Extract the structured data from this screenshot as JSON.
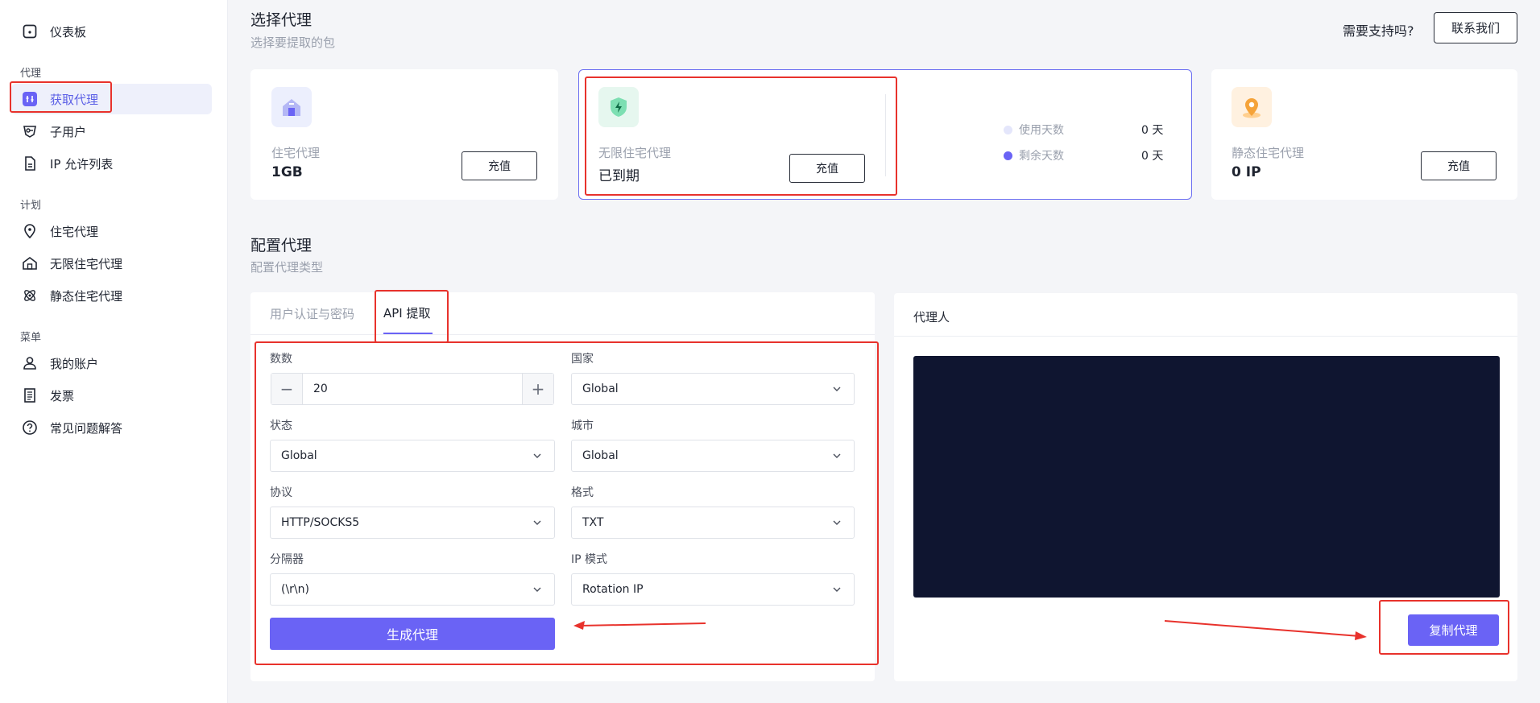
{
  "sidebar": {
    "dashboard": "仪表板",
    "section_proxy": "代理",
    "get_proxy": "获取代理",
    "sub_users": "子用户",
    "ip_allowlist": "IP 允许列表",
    "section_plan": "计划",
    "residential": "住宅代理",
    "unlimited_residential": "无限住宅代理",
    "static_residential": "静态住宅代理",
    "section_menu": "菜单",
    "my_account": "我的账户",
    "invoices": "发票",
    "faq": "常见问题解答"
  },
  "header": {
    "title": "选择代理",
    "subtitle": "选择要提取的包",
    "support_text": "需要支持吗?",
    "contact_label": "联系我们"
  },
  "cards": {
    "residential": {
      "label": "住宅代理",
      "value": "1GB",
      "button": "充值"
    },
    "unlimited": {
      "label": "无限住宅代理",
      "value": "已到期",
      "button": "充值",
      "used_days_label": "使用天数",
      "used_days_value": "0 天",
      "remaining_days_label": "剩余天数",
      "remaining_days_value": "0 天"
    },
    "static": {
      "label": "静态住宅代理",
      "value": "0 IP",
      "button": "充值"
    }
  },
  "config": {
    "title": "配置代理",
    "subtitle": "配置代理类型",
    "tabs": [
      "用户认证与密码",
      "API 提取"
    ],
    "quantity_label": "数数",
    "quantity_value": "20",
    "country_label": "国家",
    "country_value": "Global",
    "state_label": "状态",
    "state_value": "Global",
    "city_label": "城市",
    "city_value": "Global",
    "protocol_label": "协议",
    "protocol_value": "HTTP/SOCKS5",
    "format_label": "格式",
    "format_value": "TXT",
    "separator_label": "分隔器",
    "separator_value": "(\\r\\n)",
    "ip_mode_label": "IP 模式",
    "ip_mode_value": "Rotation IP",
    "generate_label": "生成代理"
  },
  "output": {
    "title": "代理人",
    "copy_label": "复制代理"
  },
  "colors": {
    "accent": "#6a63f5",
    "annotation": "#e8322c",
    "output_bg": "#0f1530"
  }
}
